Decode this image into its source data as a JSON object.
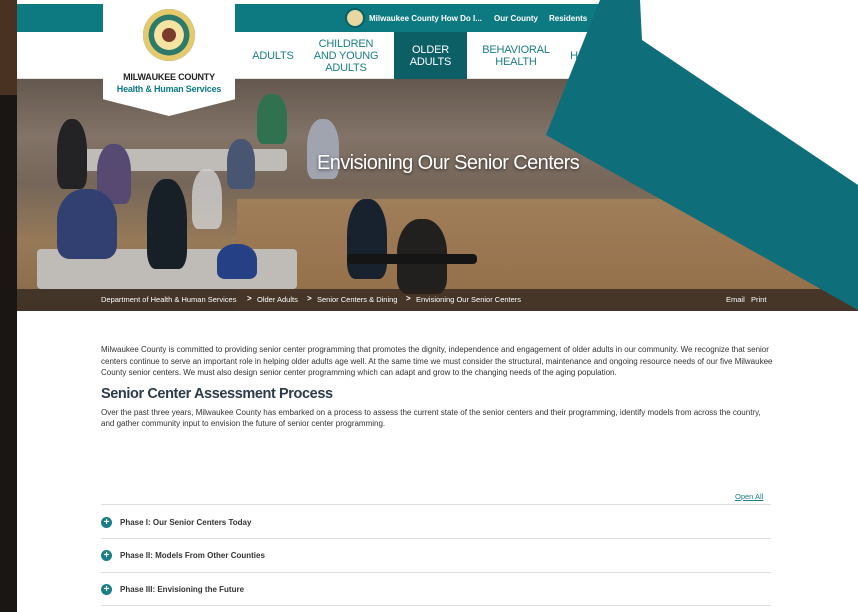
{
  "topbar": {
    "links": [
      "Milwaukee County",
      "How Do I...",
      "Our County",
      "Residents"
    ]
  },
  "logo": {
    "line1": "MILWAUKEE COUNTY",
    "line2": "Health & Human Services"
  },
  "nav": {
    "items": [
      {
        "label": "ADULTS"
      },
      {
        "label": "CHILDREN AND YOUNG ADULTS"
      },
      {
        "label": "OLDER ADULTS",
        "active": true
      },
      {
        "label": "BEHAVIORAL HEALTH"
      },
      {
        "label": "H"
      }
    ]
  },
  "hero": {
    "title": "Envisioning Our Senior Centers"
  },
  "breadcrumb": {
    "items": [
      "Department of Health & Human Services",
      "Older Adults",
      "Senior Centers & Dining",
      "Envisioning Our Senior Centers"
    ],
    "separator": ">",
    "email": "Email",
    "print": "Print"
  },
  "content": {
    "intro": "Milwaukee County is committed to providing senior center programming that promotes the dignity, independence and engagement of older adults in our community. We recognize that senior centers continue to serve an important role in helping older adults age well. At the same time we must consider the structural, maintenance and ongoing resource needs of our five Milwaukee County senior centers. We must also design senior center programming which can adapt and grow to the changing needs of the aging population.",
    "heading": "Senior Center Assessment Process",
    "paragraph": "Over the past three years, Milwaukee County has embarked on a process to assess the current state of the senior centers and their programming, identify models from across the country, and gather community input to envision the future of senior center programming."
  },
  "accordion": {
    "open_all": "Open All",
    "items": [
      {
        "label": "Phase I: Our Senior Centers Today"
      },
      {
        "label": "Phase II: Models From Other Counties"
      },
      {
        "label": "Phase III: Envisioning the Future"
      }
    ],
    "icon": "plus-circle-icon"
  },
  "colors": {
    "teal": "#0d7a82",
    "dark_teal": "#0d5f66",
    "overlay_teal": "#0e6e79"
  }
}
